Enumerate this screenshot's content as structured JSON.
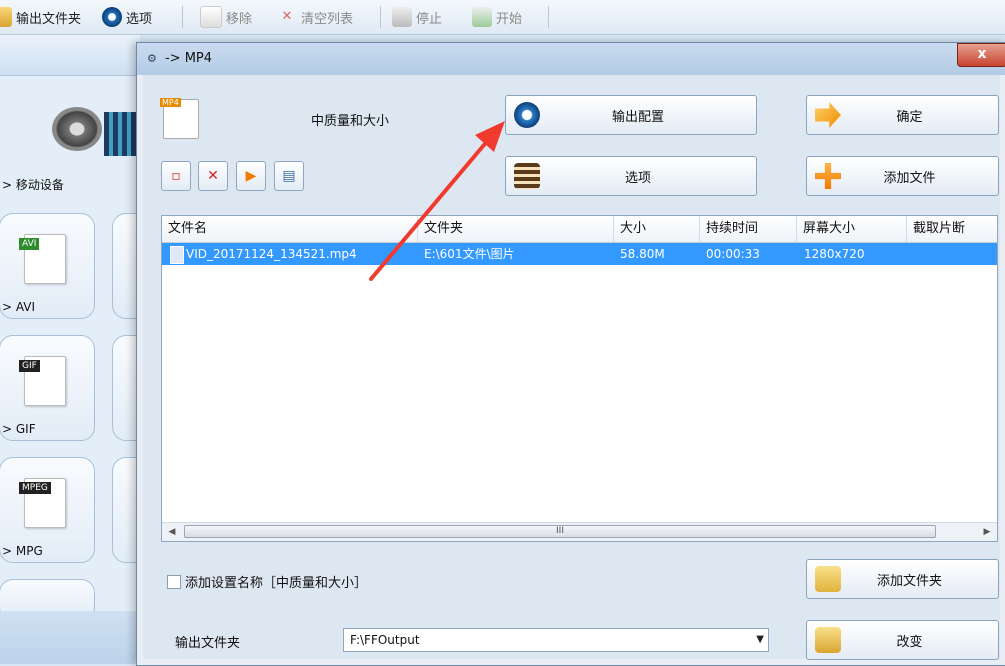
{
  "app": {
    "toolbar": {
      "output_folder": "输出文件夹",
      "options": "选项",
      "remove": "移除",
      "clear_list": "清空列表",
      "stop": "停止",
      "start": "开始"
    },
    "sidebar": {
      "category": "> 移动设备",
      "cards": [
        {
          "label": "> AVI",
          "tag": "AVI"
        },
        {
          "label": "> GIF",
          "tag": "GIF"
        },
        {
          "label": "> MPG",
          "tag": "MPEG"
        }
      ]
    }
  },
  "dialog": {
    "title": "-> MP4",
    "close": "x",
    "preset_tag": "MP4",
    "preset_name": "中质量和大小",
    "buttons": {
      "output_config": "输出配置",
      "confirm": "确定",
      "options": "选项",
      "add_file": "添加文件",
      "add_folder": "添加文件夹",
      "change": "改变"
    },
    "table": {
      "columns": [
        "文件名",
        "文件夹",
        "大小",
        "持续时间",
        "屏幕大小",
        "截取片断"
      ],
      "rows": [
        {
          "name": "VID_20171124_134521.mp4",
          "folder": "E:\\601文件\\图片",
          "size": "58.80M",
          "duration": "00:00:33",
          "screen": "1280x720",
          "clip": ""
        }
      ],
      "scroll_grip": "III"
    },
    "checkbox_label": "添加设置名称［中质量和大小］",
    "output_label": "输出文件夹",
    "output_path": "F:\\FFOutput"
  },
  "colors": {
    "selection": "#3399ff",
    "annotation_arrow": "#f03a2e"
  }
}
